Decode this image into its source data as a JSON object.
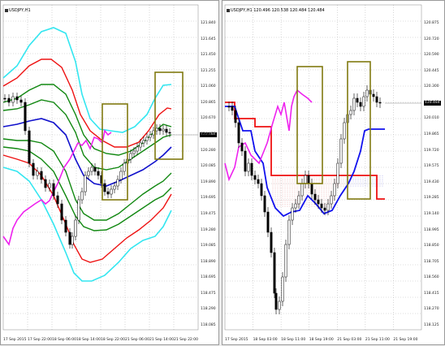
{
  "left": {
    "title": "USDJPY,H1",
    "price_tag": "120.484",
    "y_labels": [
      "121.840",
      "121.645",
      "121.450",
      "121.255",
      "121.060",
      "120.865",
      "120.670",
      "120.475",
      "120.280",
      "120.085",
      "119.890",
      "119.695",
      "119.475",
      "119.280",
      "119.085",
      "118.890",
      "118.695",
      "118.475",
      "118.290",
      "118.085"
    ],
    "x_labels": [
      "17 Sep 2015",
      "17 Sep 22:00",
      "18 Sep 06:00",
      "18 Sep 14:00",
      "18 Sep 22:00",
      "21 Sep 06:00",
      "21 Sep 14:00",
      "21 Sep 22:00"
    ]
  },
  "right": {
    "title": "USDJPY,H1 120.496 120.538 120.484 120.484",
    "price_tag": "120.484",
    "y_labels": [
      "120.875",
      "120.720",
      "120.590",
      "120.445",
      "120.300",
      "120.155",
      "120.010",
      "119.865",
      "119.720",
      "119.575",
      "119.430",
      "119.285",
      "119.140",
      "118.995",
      "118.850",
      "118.705",
      "118.560",
      "118.415",
      "118.270",
      "118.125"
    ],
    "x_labels": [
      "17 Sep 2015",
      "18 Sep 03:00",
      "18 Sep 11:00",
      "18 Sep 19:00",
      "21 Sep 03:00",
      "21 Sep 11:00",
      "21 Sep 19:00"
    ]
  },
  "left_title": "USDJPY,H1"
}
